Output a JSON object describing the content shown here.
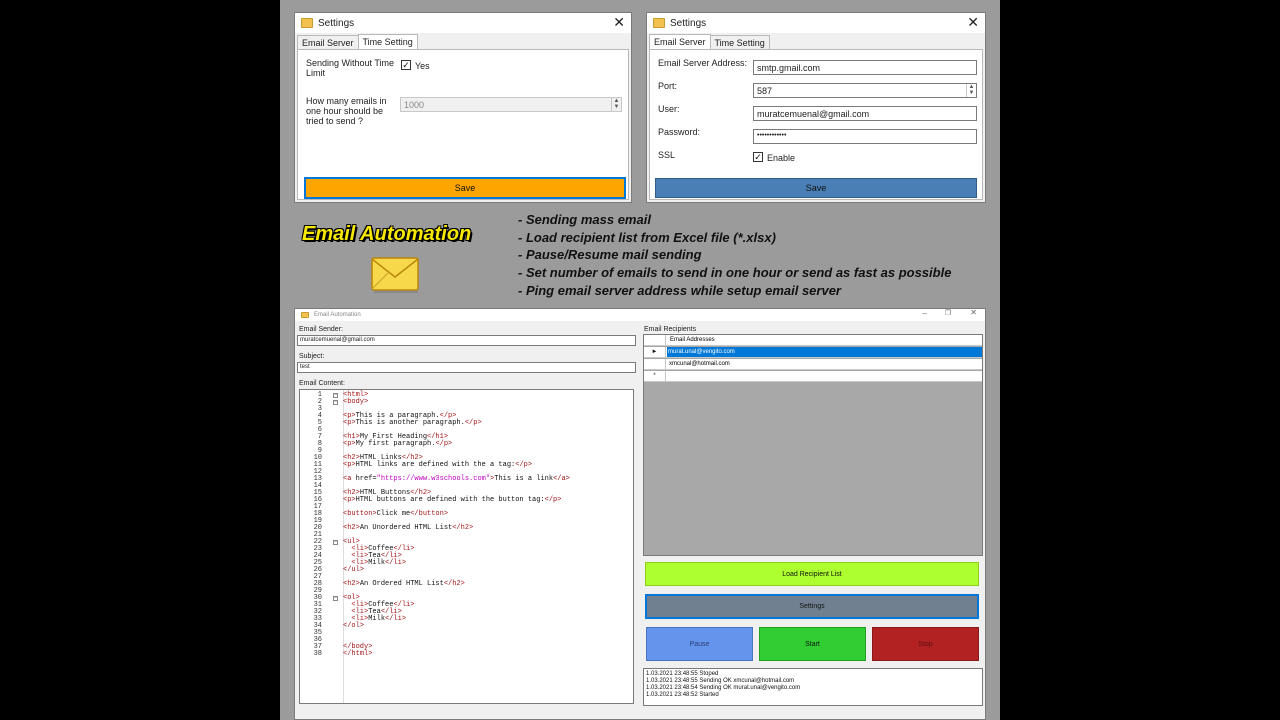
{
  "settings_time": {
    "title": "Settings",
    "tabs": [
      "Email Server",
      "Time Setting"
    ],
    "sending_without_label": "Sending Without Time Limit",
    "yes_label": "Yes",
    "emails_per_hour_label": "How many emails in one hour should be tried to send ?",
    "emails_per_hour_value": "1000",
    "save_label": "Save"
  },
  "settings_server": {
    "title": "Settings",
    "tabs": [
      "Email Server",
      "Time Setting"
    ],
    "address_label": "Email Server Address:",
    "address_value": "smtp.gmail.com",
    "port_label": "Port:",
    "port_value": "587",
    "user_label": "User:",
    "user_value": "muratcemuenal@gmail.com",
    "password_label": "Password:",
    "password_value": "••••••••••••",
    "ssl_label": "SSL",
    "enable_label": "Enable",
    "save_label": "Save"
  },
  "promo": {
    "brand": "Email Automation",
    "features": [
      "- Sending mass email",
      "- Load recipient list from Excel file (*.xlsx)",
      "- Pause/Resume mail sending",
      "- Set number of emails to send in one hour or send as fast as possible",
      "- Ping email server address while setup email server"
    ]
  },
  "app": {
    "title": "Email Automation",
    "sender_label": "Email Sender:",
    "sender_value": "muratcemuenal@gmail.com",
    "subject_label": "Subject:",
    "subject_value": "test",
    "content_label": "Email Content:",
    "recipients_label": "Email Recipients",
    "grid_header": "Email Addresses",
    "recipients": [
      "murat.unal@vengito.com",
      "xmcunal@hotmail.com"
    ],
    "load_label": "Load Recipient List",
    "settings_label": "Settings",
    "pause_label": "Pause",
    "start_label": "Start",
    "stop_label": "Stop",
    "log": [
      "1.03.2021 23:48:55 Stoped",
      "1.03.2021 23:48:55 Sending OK  xmcunal@hotmail.com",
      "1.03.2021 23:48:54 Sending OK  murat.unal@vengito.com",
      "1.03.2021 23:48:52 Started"
    ],
    "code_lines": [
      "<html>",
      "<body>",
      "",
      "<p>This is a paragraph.</p>",
      "<p>This is another paragraph.</p>",
      "",
      "<h1>My First Heading</h1>",
      "<p>My first paragraph.</p>",
      "",
      "<h2>HTML Links</h2>",
      "<p>HTML links are defined with the a tag:</p>",
      "",
      "<a href=\"https://www.w3schools.com\">This is a link</a>",
      "",
      "<h2>HTML Buttons</h2>",
      "<p>HTML buttons are defined with the button tag:</p>",
      "",
      "<button>Click me</button>",
      "",
      "<h2>An Unordered HTML List</h2>",
      "",
      "<ul>",
      "  <li>Coffee</li>",
      "  <li>Tea</li>",
      "  <li>Milk</li>",
      "</ul>",
      "",
      "<h2>An Ordered HTML List</h2>",
      "",
      "<ol>",
      "  <li>Coffee</li>",
      "  <li>Tea</li>",
      "  <li>Milk</li>",
      "</ol>",
      "",
      "",
      "</body>",
      "</html>"
    ]
  },
  "colors": {
    "save_orange": "#ffa500",
    "save_blue": "#4a7fb5",
    "load_green": "#adff2f",
    "settings_gray": "#708090",
    "pause_blue": "#6495ed",
    "start_green": "#32cd32",
    "stop_red": "#b22222",
    "selection_blue": "#0078d7",
    "brand_yellow": "#f6e800"
  },
  "icons": [
    "settings-app-icon",
    "close-icon",
    "envelope-icon",
    "checkmark-icon",
    "row-pointer-icon"
  ]
}
